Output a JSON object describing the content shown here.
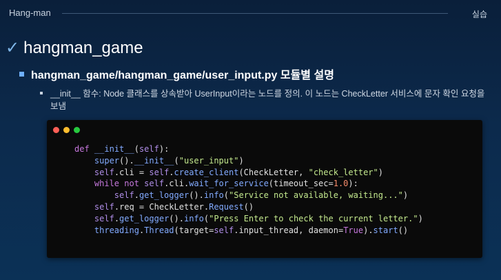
{
  "header": {
    "left": "Hang-man",
    "right": "실습"
  },
  "title": {
    "check": "✓",
    "text": "hangman_game"
  },
  "subtitle": "hangman_game/hangman_game/user_input.py 모듈별 설명",
  "description": "__init__ 함수: Node 클래스를 상속받아 UserInput이라는 노드를 정의. 이 노드는 CheckLetter 서비스에 문자 확인 요청을 보냄",
  "code_lines": [
    "def __init__(self):",
    "    super().__init__(\"user_input\")",
    "    self.cli = self.create_client(CheckLetter, \"check_letter\")",
    "    while not self.cli.wait_for_service(timeout_sec=1.0):",
    "        self.get_logger().info(\"Service not available, waiting...\")",
    "    self.req = CheckLetter.Request()",
    "    self.get_logger().info(\"Press Enter to check the current letter.\")",
    "    threading.Thread(target=self.input_thread, daemon=True).start()"
  ]
}
